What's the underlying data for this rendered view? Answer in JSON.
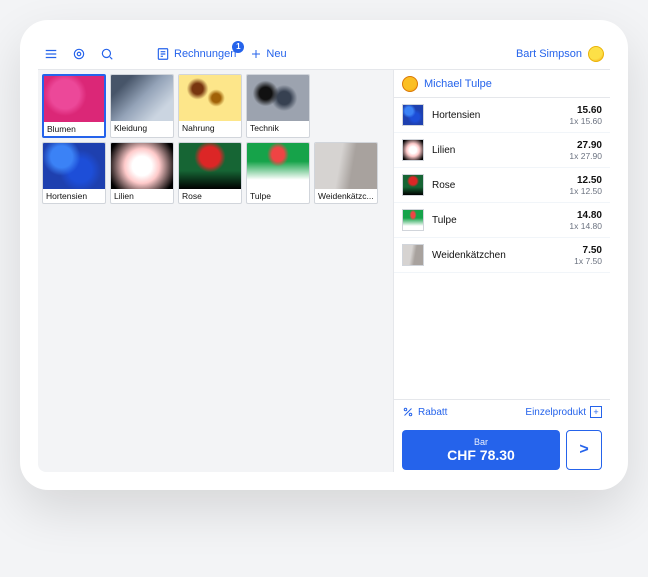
{
  "topbar": {
    "rechnungen_label": "Rechnungen",
    "rechnungen_badge": "1",
    "neu_label": "Neu",
    "user_name": "Bart Simpson"
  },
  "categories": [
    {
      "key": "flowers",
      "label": "Blumen",
      "selected": true
    },
    {
      "key": "clothing",
      "label": "Kleidung",
      "selected": false
    },
    {
      "key": "food",
      "label": "Nahrung",
      "selected": false
    },
    {
      "key": "tech",
      "label": "Technik",
      "selected": false
    }
  ],
  "products": [
    {
      "key": "hortensien",
      "label": "Hortensien"
    },
    {
      "key": "lilien",
      "label": "Lilien"
    },
    {
      "key": "rose",
      "label": "Rose"
    },
    {
      "key": "tulpe",
      "label": "Tulpe"
    },
    {
      "key": "weiden",
      "label": "Weidenkätzc..."
    }
  ],
  "cart": {
    "customer_name": "Michael Tulpe",
    "items": [
      {
        "thumb": "hortensien",
        "name": "Hortensien",
        "price": "15.60",
        "detail": "1x 15.60"
      },
      {
        "thumb": "lilien",
        "name": "Lilien",
        "price": "27.90",
        "detail": "1x 27.90"
      },
      {
        "thumb": "rose",
        "name": "Rose",
        "price": "12.50",
        "detail": "1x 12.50"
      },
      {
        "thumb": "tulpe",
        "name": "Tulpe",
        "price": "14.80",
        "detail": "1x 14.80"
      },
      {
        "thumb": "weiden",
        "name": "Weidenkätzchen",
        "price": "7.50",
        "detail": "1x 7.50"
      }
    ],
    "rabatt_label": "Rabatt",
    "einzel_label": "Einzelprodukt",
    "pay_method_label": "Bar",
    "pay_amount": "CHF 78.30",
    "next_glyph": ">"
  }
}
